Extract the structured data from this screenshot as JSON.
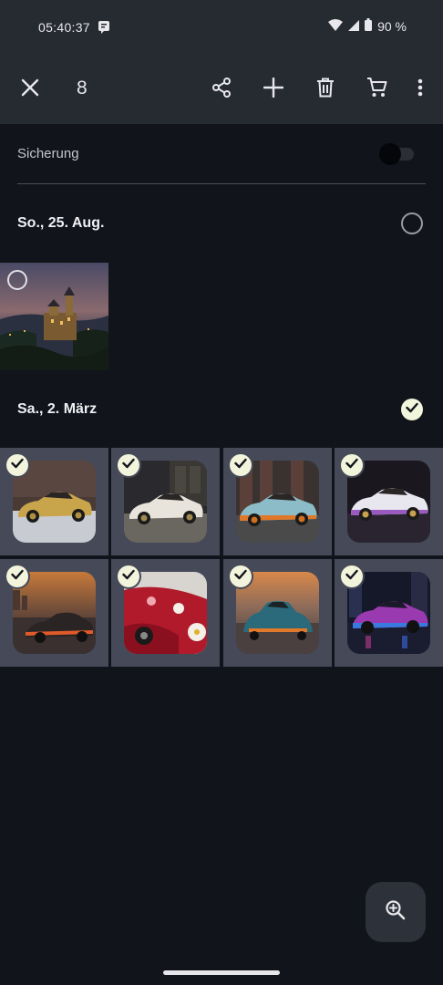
{
  "status_bar": {
    "time": "05:40:37",
    "battery": "90 %",
    "icons": [
      "notification-icon",
      "wifi-icon",
      "signal-icon",
      "battery-icon"
    ]
  },
  "toolbar": {
    "selected_count": "8",
    "actions": [
      "close-icon",
      "share-icon",
      "add-icon",
      "delete-icon",
      "cart-icon",
      "more-icon"
    ]
  },
  "backup": {
    "label": "Sicherung",
    "enabled": false
  },
  "groups": [
    {
      "date": "So., 25. Aug.",
      "all_selected": false,
      "photos": [
        {
          "subject": "castle at dusk",
          "selected": false
        }
      ]
    },
    {
      "date": "Sa., 2. März",
      "all_selected": true,
      "photos": [
        {
          "subject": "gold sports car",
          "selected": true
        },
        {
          "subject": "white sports car in garage",
          "selected": true
        },
        {
          "subject": "light blue sports car",
          "selected": true
        },
        {
          "subject": "white purple sports car",
          "selected": true
        },
        {
          "subject": "orange sports car at sunset",
          "selected": true
        },
        {
          "subject": "red floral sports car",
          "selected": true
        },
        {
          "subject": "teal sports car at sunset",
          "selected": true
        },
        {
          "subject": "purple neon sports car",
          "selected": true
        }
      ]
    }
  ],
  "fab": {
    "icon": "zoom-in-icon"
  },
  "colors": {
    "background": "#11141b",
    "toolbar": "#262a31",
    "selected_cell": "#464a58",
    "check": "#f2f4dc"
  }
}
